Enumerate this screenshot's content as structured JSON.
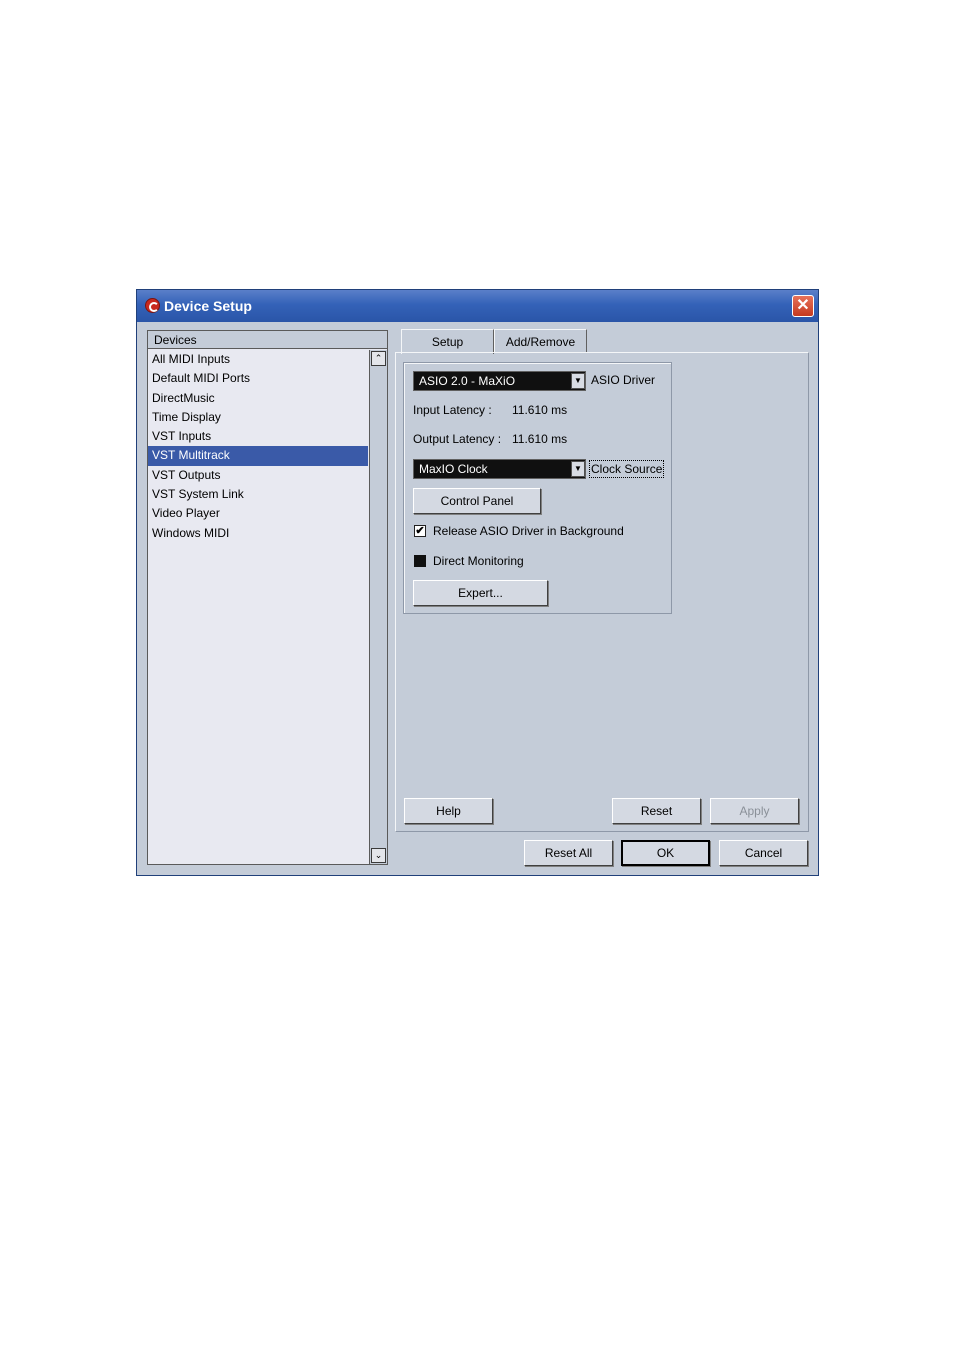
{
  "window": {
    "title": "Device Setup",
    "close_glyph": "✕",
    "app_icon": "cubase-logo-icon"
  },
  "devices": {
    "header": "Devices",
    "items": [
      {
        "label": "All MIDI Inputs"
      },
      {
        "label": "Default MIDI Ports"
      },
      {
        "label": "DirectMusic"
      },
      {
        "label": "Time Display"
      },
      {
        "label": "VST Inputs"
      },
      {
        "label": "VST Multitrack",
        "selected": true
      },
      {
        "label": "VST Outputs"
      },
      {
        "label": "VST System Link"
      },
      {
        "label": "Video Player"
      },
      {
        "label": "Windows MIDI"
      }
    ],
    "scroll_up": "⌃",
    "scroll_down": "⌄"
  },
  "tabs": [
    {
      "label": "Setup",
      "active": true
    },
    {
      "label": "Add/Remove",
      "active": false
    }
  ],
  "setup": {
    "driver_value": "ASIO 2.0 - MaXiO",
    "driver_label": "ASIO Driver",
    "input_latency_label": "Input Latency :",
    "input_latency_value": "11.610 ms",
    "output_latency_label": "Output Latency :",
    "output_latency_value": "11.610 ms",
    "clock_value": "MaxIO Clock",
    "clock_label": "Clock Source",
    "control_panel": "Control Panel",
    "release_label": "Release ASIO Driver in Background",
    "release_checked": true,
    "direct_label": "Direct Monitoring",
    "direct_checked": false,
    "expert": "Expert...",
    "arrow_glyph": "▼",
    "check_glyph": "✔"
  },
  "buttons": {
    "help": "Help",
    "reset": "Reset",
    "apply": "Apply",
    "reset_all": "Reset All",
    "ok": "OK",
    "cancel": "Cancel"
  }
}
